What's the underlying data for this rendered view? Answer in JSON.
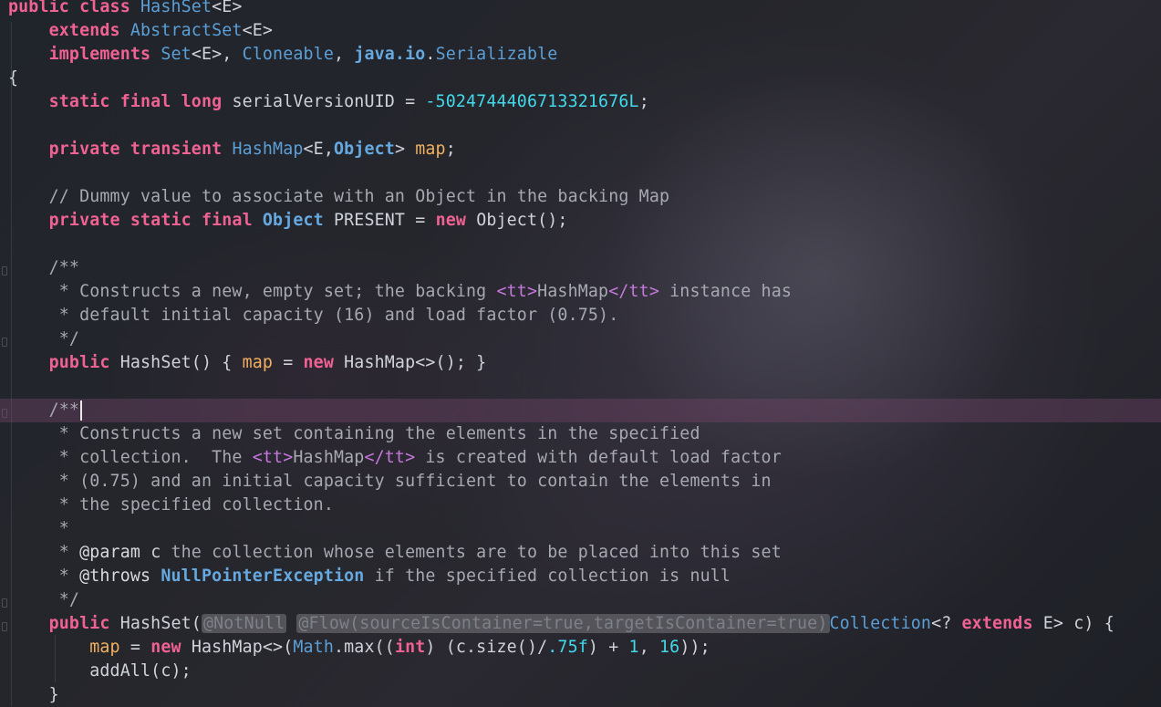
{
  "editor": {
    "language": "Java",
    "class_name": "HashSet",
    "current_line_index": 17,
    "colors": {
      "keyword": "#f06292",
      "type": "#5c9fd6",
      "field": "#f0b060",
      "number": "#42d9ea",
      "comment": "#a6a9b1",
      "html_tag": "#c678dd",
      "current_line": "#5a3150"
    },
    "lines": [
      [
        [
          "kw",
          "public class "
        ],
        [
          "ty",
          "HashSet"
        ],
        [
          "pl",
          "<E>"
        ]
      ],
      [
        [
          "pl",
          "    "
        ],
        [
          "kw",
          "extends "
        ],
        [
          "ty",
          "AbstractSet"
        ],
        [
          "pl",
          "<E>"
        ]
      ],
      [
        [
          "pl",
          "    "
        ],
        [
          "kw",
          "implements "
        ],
        [
          "ty",
          "Set"
        ],
        [
          "pl",
          "<E>, "
        ],
        [
          "ty",
          "Cloneable"
        ],
        [
          "pl",
          ", "
        ],
        [
          "tyb",
          "java.io"
        ],
        [
          "pl",
          "."
        ],
        [
          "ty",
          "Serializable"
        ]
      ],
      [
        [
          "pl",
          "{"
        ]
      ],
      [
        [
          "pl",
          "    "
        ],
        [
          "kw",
          "static final long "
        ],
        [
          "pl",
          "serialVersionUID = "
        ],
        [
          "nm",
          "-5024744406713321676L"
        ],
        [
          "pl",
          ";"
        ]
      ],
      [],
      [
        [
          "pl",
          "    "
        ],
        [
          "kw",
          "private transient "
        ],
        [
          "ty",
          "HashMap"
        ],
        [
          "pl",
          "<E,"
        ],
        [
          "tyb",
          "Object"
        ],
        [
          "pl",
          "> "
        ],
        [
          "fd",
          "map"
        ],
        [
          "pl",
          ";"
        ]
      ],
      [],
      [
        [
          "pl",
          "    "
        ],
        [
          "cm",
          "// Dummy value to associate with an Object in the backing Map"
        ]
      ],
      [
        [
          "pl",
          "    "
        ],
        [
          "kw",
          "private static final "
        ],
        [
          "tyb",
          "Object"
        ],
        [
          "pl",
          " PRESENT = "
        ],
        [
          "kw",
          "new "
        ],
        [
          "pl",
          "Object();"
        ]
      ],
      [],
      [
        [
          "pl",
          "    "
        ],
        [
          "cm",
          "/**"
        ]
      ],
      [
        [
          "pl",
          "     "
        ],
        [
          "cm",
          "* Constructs a new, empty set; the backing "
        ],
        [
          "tg",
          "<tt>"
        ],
        [
          "cm",
          "HashMap"
        ],
        [
          "tg",
          "</tt>"
        ],
        [
          "cm",
          " instance has"
        ]
      ],
      [
        [
          "pl",
          "     "
        ],
        [
          "cm",
          "* default initial capacity (16) and load factor (0.75)."
        ]
      ],
      [
        [
          "pl",
          "     "
        ],
        [
          "cm",
          "*/"
        ]
      ],
      [
        [
          "pl",
          "    "
        ],
        [
          "kw",
          "public "
        ],
        [
          "pl",
          "HashSet() { "
        ],
        [
          "fd",
          "map"
        ],
        [
          "pl",
          " = "
        ],
        [
          "kw",
          "new "
        ],
        [
          "pl",
          "HashMap<>(); }"
        ]
      ],
      [],
      [
        [
          "pl",
          "    "
        ],
        [
          "cm",
          "/**"
        ]
      ],
      [
        [
          "pl",
          "     "
        ],
        [
          "cm",
          "* Constructs a new set containing the elements in the specified"
        ]
      ],
      [
        [
          "pl",
          "     "
        ],
        [
          "cm",
          "* collection.  The "
        ],
        [
          "tg",
          "<tt>"
        ],
        [
          "cm",
          "HashMap"
        ],
        [
          "tg",
          "</tt>"
        ],
        [
          "cm",
          " is created with default load factor"
        ]
      ],
      [
        [
          "pl",
          "     "
        ],
        [
          "cm",
          "* (0.75) and an initial capacity sufficient to contain the elements in"
        ]
      ],
      [
        [
          "pl",
          "     "
        ],
        [
          "cm",
          "* the specified collection."
        ]
      ],
      [
        [
          "pl",
          "     "
        ],
        [
          "cm",
          "*"
        ]
      ],
      [
        [
          "pl",
          "     "
        ],
        [
          "cm",
          "* "
        ],
        [
          "jd",
          "@param "
        ],
        [
          "pl",
          "c "
        ],
        [
          "cm",
          "the collection whose elements are to be placed into this set"
        ]
      ],
      [
        [
          "pl",
          "     "
        ],
        [
          "cm",
          "* "
        ],
        [
          "jd",
          "@throws "
        ],
        [
          "tyb",
          "NullPointerException"
        ],
        [
          "cm",
          " if the specified collection is null"
        ]
      ],
      [
        [
          "pl",
          "     "
        ],
        [
          "cm",
          "*/"
        ]
      ],
      [
        [
          "pl",
          "    "
        ],
        [
          "kw",
          "public "
        ],
        [
          "pl",
          "HashSet("
        ],
        [
          "chip",
          "@NotNull"
        ],
        [
          "pl",
          " "
        ],
        [
          "chip",
          "@Flow(sourceIsContainer=true,targetIsContainer=true)"
        ],
        [
          "ty",
          "Collection"
        ],
        [
          "pl",
          "<? "
        ],
        [
          "kw",
          "extends "
        ],
        [
          "pl",
          "E> c) {"
        ]
      ],
      [
        [
          "pl",
          "        "
        ],
        [
          "fd",
          "map"
        ],
        [
          "pl",
          " = "
        ],
        [
          "kw",
          "new "
        ],
        [
          "pl",
          "HashMap<>("
        ],
        [
          "ty",
          "Math"
        ],
        [
          "pl",
          ".max(("
        ],
        [
          "kw",
          "int"
        ],
        [
          "pl",
          ") (c.size()/"
        ],
        [
          "nm",
          ".75f"
        ],
        [
          "pl",
          ") + "
        ],
        [
          "nm",
          "1"
        ],
        [
          "pl",
          ", "
        ],
        [
          "nm",
          "16"
        ],
        [
          "pl",
          "));"
        ]
      ],
      [
        [
          "pl",
          "        addAll(c);"
        ]
      ],
      [
        [
          "pl",
          "    }"
        ]
      ]
    ]
  }
}
